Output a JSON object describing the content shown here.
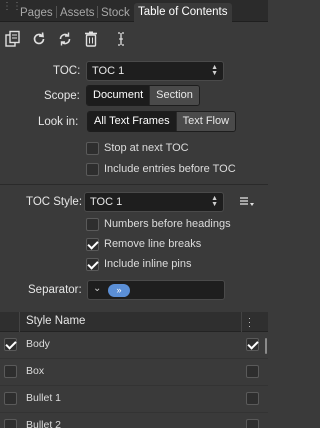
{
  "tabs": [
    {
      "label": "Pages",
      "active": false
    },
    {
      "label": "Assets",
      "active": false
    },
    {
      "label": "Stock",
      "active": false
    },
    {
      "label": "Table of Contents",
      "active": true
    }
  ],
  "toolbar": {
    "icons": [
      "insert-toc-icon",
      "update-toc-icon",
      "update-all-toc-icon",
      "delete-toc-icon",
      "text-cursor-icon"
    ]
  },
  "toc": {
    "label": "TOC:",
    "value": "TOC 1"
  },
  "scope": {
    "label": "Scope:",
    "options": [
      "Document",
      "Section"
    ],
    "selected": "Document"
  },
  "look_in": {
    "label": "Look in:",
    "options": [
      "All Text Frames",
      "Text Flow"
    ],
    "selected": "All Text Frames"
  },
  "options1": [
    {
      "label": "Stop at next TOC",
      "checked": false
    },
    {
      "label": "Include entries before TOC",
      "checked": false
    }
  ],
  "toc_style": {
    "label": "TOC Style:",
    "value": "TOC 1"
  },
  "options2": [
    {
      "label": "Numbers before headings",
      "checked": false
    },
    {
      "label": "Remove line breaks",
      "checked": true
    },
    {
      "label": "Include inline pins",
      "checked": true
    }
  ],
  "separator": {
    "label": "Separator:",
    "token": "»"
  },
  "table": {
    "header": "Style Name",
    "rows": [
      {
        "name": "Body",
        "include": true,
        "right": true
      },
      {
        "name": "Box",
        "include": false,
        "right": false
      },
      {
        "name": "Bullet 1",
        "include": false,
        "right": false
      },
      {
        "name": "Bullet 2",
        "include": false,
        "right": false
      }
    ]
  },
  "colors": {
    "background": "#3a3a3a",
    "field": "#1e1e1e",
    "accent": "#5b8fd6"
  }
}
